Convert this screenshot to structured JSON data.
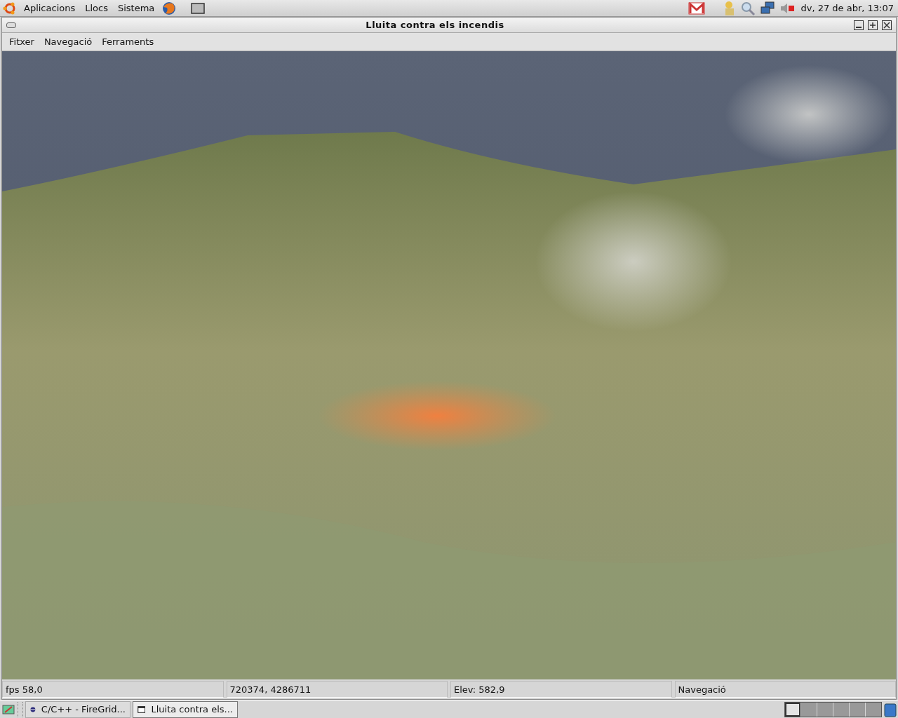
{
  "top_panel": {
    "menus": [
      "Aplicacions",
      "Llocs",
      "Sistema"
    ],
    "clock": "dv, 27 de abr, 13:07"
  },
  "window": {
    "title": "Lluita contra els incendis"
  },
  "menu_bar": [
    "Fitxer",
    "Navegació",
    "Ferraments"
  ],
  "status_bar": [
    "fps 58,0",
    "720374, 4286711",
    "Elev: 582,9",
    "Navegació"
  ],
  "taskbar": {
    "tasks": [
      {
        "label": "C/C++ - FireGrid...",
        "selected": false
      },
      {
        "label": "Lluita contra els...",
        "selected": true
      }
    ],
    "workspaces": [
      {
        "selected": true
      },
      {
        "selected": false
      },
      {
        "selected": false
      },
      {
        "selected": false
      },
      {
        "selected": false
      },
      {
        "selected": false
      }
    ]
  }
}
